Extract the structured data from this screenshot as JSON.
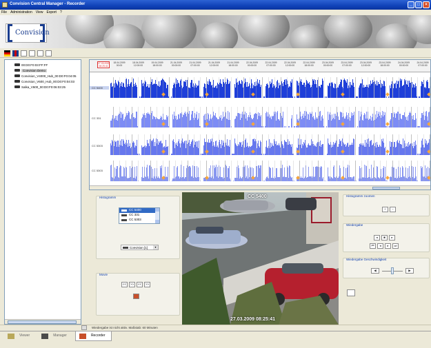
{
  "window": {
    "title": "Convision Central Manager - Recorder"
  },
  "menu": [
    "File",
    "Administration",
    "View",
    "Export",
    "?"
  ],
  "logo": {
    "text": "Convision"
  },
  "toolbar": {
    "icons": [
      "flag-de-icon",
      "flag-uk-icon",
      "search-icon",
      "new-document-icon",
      "folder-icon",
      "save-icon"
    ]
  },
  "tree": {
    "items": [
      {
        "label": "00:D0:F0:03:FF:FF",
        "selected": false
      },
      {
        "label": "Convision Demo",
        "selected": true
      },
      {
        "label": "Convision_V4000_Hub_00:D0:F0:04:05",
        "selected": false
      },
      {
        "label": "Convision_V600_Hub_00:D0:F0:04:03",
        "selected": false
      },
      {
        "label": "Salka_V600_00:D0:F0:06:03:25",
        "selected": false
      }
    ]
  },
  "timeline": {
    "current_date": "27.03.2009",
    "current_time": "08:25:41",
    "dates": [
      {
        "date": "18.04.2009",
        "time": "00:00"
      },
      {
        "date": "18.04.2009",
        "time": "12:00:00"
      },
      {
        "date": "19.04.2009",
        "time": "18:00:00"
      },
      {
        "date": "21.04.2009",
        "time": "00:00:00"
      },
      {
        "date": "21.04.2009",
        "time": "07:00:00"
      },
      {
        "date": "21.04.2009",
        "time": "12:00:00"
      },
      {
        "date": "21.04.2009",
        "time": "18:00:00"
      },
      {
        "date": "22.04.2009",
        "time": "00:00:00"
      },
      {
        "date": "22.04.2009",
        "time": "07:00:00"
      },
      {
        "date": "22.04.2009",
        "time": "12:00:00"
      },
      {
        "date": "22.04.2009",
        "time": "18:00:00"
      },
      {
        "date": "23.04.2009",
        "time": "00:00:00"
      },
      {
        "date": "23.04.2009",
        "time": "07:00:00"
      },
      {
        "date": "23.04.2009",
        "time": "12:00:00"
      },
      {
        "date": "23.04.2009",
        "time": "18:00:00"
      },
      {
        "date": "24.04.2009",
        "time": "00:00:00"
      },
      {
        "date": "24.04.2009",
        "time": "07:00:00"
      }
    ],
    "tracks": [
      {
        "label": "CC 5400",
        "active": true,
        "color": "#1f3fd9"
      },
      {
        "label": "CC 331",
        "active": false,
        "color": "#7d8cf5"
      },
      {
        "label": "CC 5303",
        "active": false,
        "color": "#6677ee"
      },
      {
        "label": "CC 5303",
        "active": false,
        "color": "#8896f0"
      }
    ]
  },
  "histogram": {
    "title": "Histogramm",
    "cameras": [
      {
        "label": "CC 5400",
        "selected": true
      },
      {
        "label": "CC 331",
        "selected": false
      },
      {
        "label": "CC 5303",
        "selected": false
      }
    ],
    "selector_value": "Convision [1]"
  },
  "movie": {
    "title": "Movie",
    "buttons": [
      "<<",
      ">>",
      "<<",
      ">>"
    ]
  },
  "video": {
    "camera_label": "CC 5400",
    "timestamp": "27.03.2009 08:25:41"
  },
  "right_panel": {
    "zoom_title": "Histogramm zoomen",
    "playback_title": "Wiedergabe",
    "speed_title": "Wiedergabe Geschwindigkeit",
    "speed_level": 0.5
  },
  "status": {
    "text": "Wiedergabe ist nicht aktiv. Maßstab: 60 Minuten"
  },
  "bottom_tabs": [
    {
      "label": "Viewer",
      "active": false
    },
    {
      "label": "Manager",
      "active": false
    },
    {
      "label": "Recorder",
      "active": true
    }
  ]
}
